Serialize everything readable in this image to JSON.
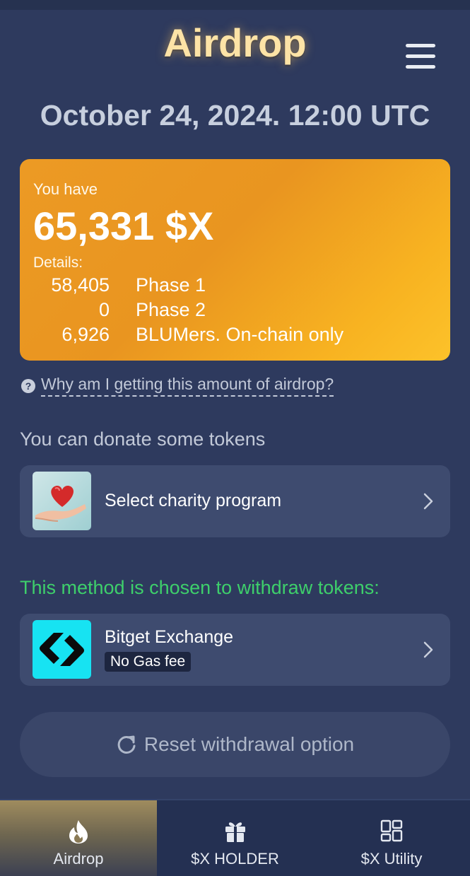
{
  "header": {
    "title": "Airdrop",
    "menu_icon": "hamburger-menu-icon"
  },
  "date": "October 24, 2024. 12:00 UTC",
  "balance": {
    "label": "You have",
    "amount": "65,331 $X",
    "details_label": "Details:",
    "rows": [
      {
        "value": "58,405",
        "label": "Phase 1"
      },
      {
        "value": "0",
        "label": "Phase 2"
      },
      {
        "value": "6,926",
        "label": "BLUMers. On-chain only"
      }
    ],
    "gradient_colors": [
      "#ec9a24",
      "#fcc22a"
    ]
  },
  "faq": {
    "icon": "question-circle-icon",
    "link_text": "Why am I getting this amount of airdrop?"
  },
  "donate": {
    "heading": "You can donate some tokens",
    "option_label": "Select charity program",
    "option_icon": "heart-in-hand-icon"
  },
  "withdraw": {
    "heading": "This method is chosen to withdraw tokens:",
    "method_name": "Bitget Exchange",
    "badge": "No Gas fee",
    "method_icon": "bitget-logo-icon",
    "heading_color": "#3ecf6b"
  },
  "reset_button": {
    "label": "Reset withdrawal option",
    "icon": "refresh-icon"
  },
  "bottom_nav": {
    "items": [
      {
        "label": "Airdrop",
        "icon": "flame-icon",
        "active": true
      },
      {
        "label": "$X HOLDER",
        "icon": "gift-icon",
        "active": false
      },
      {
        "label": "$X Utility",
        "icon": "dashboard-grid-icon",
        "active": false
      }
    ]
  }
}
